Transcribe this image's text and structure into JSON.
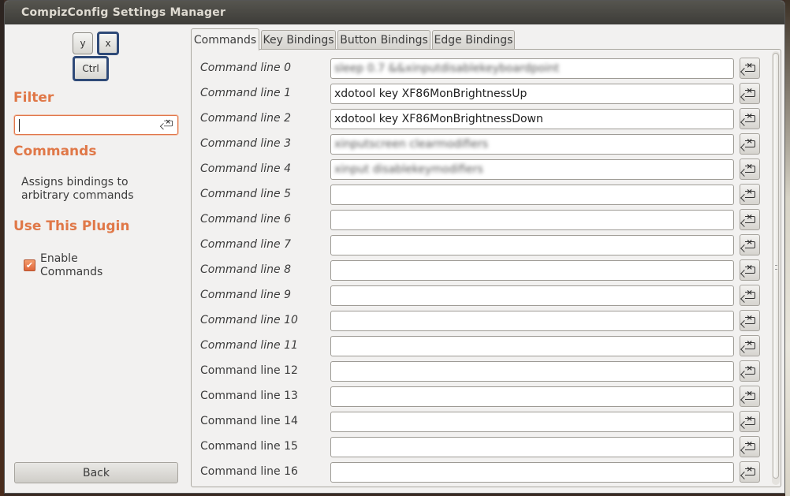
{
  "window": {
    "title": "CompizConfig Settings Manager"
  },
  "plugin_icon": {
    "keys": [
      "y",
      "x",
      "Ctrl"
    ]
  },
  "sidebar": {
    "filter_heading": "Filter",
    "filter_value": "",
    "plugin_heading": "Commands",
    "plugin_description_line1": "Assigns bindings to",
    "plugin_description_line2": "arbitrary commands",
    "use_heading": "Use This Plugin",
    "enable_label_line1": "Enable",
    "enable_label_line2": "Commands",
    "enable_checked": true,
    "back_label": "Back"
  },
  "tabs": [
    "Commands",
    "Key Bindings",
    "Button Bindings",
    "Edge Bindings"
  ],
  "active_tab": 0,
  "rows": [
    {
      "label": "Command line 0",
      "value": "sleep 0.7 &&xinputdisablekeyboardpoint",
      "italic": true,
      "blurred": true
    },
    {
      "label": "Command line 1",
      "value": "xdotool key XF86MonBrightnessUp",
      "italic": true,
      "blurred": false
    },
    {
      "label": "Command line 2",
      "value": "xdotool key XF86MonBrightnessDown",
      "italic": true,
      "blurred": false
    },
    {
      "label": "Command line 3",
      "value": "xinputscreen clearmodifiers",
      "italic": true,
      "blurred": true
    },
    {
      "label": "Command line 4",
      "value": "xinput disablekeymodifiers",
      "italic": true,
      "blurred": true
    },
    {
      "label": "Command line 5",
      "value": "",
      "italic": true,
      "blurred": false
    },
    {
      "label": "Command line 6",
      "value": "",
      "italic": true,
      "blurred": false
    },
    {
      "label": "Command line 7",
      "value": "",
      "italic": true,
      "blurred": false
    },
    {
      "label": "Command line 8",
      "value": "",
      "italic": true,
      "blurred": false
    },
    {
      "label": "Command line 9",
      "value": "",
      "italic": true,
      "blurred": false
    },
    {
      "label": "Command line 10",
      "value": "",
      "italic": true,
      "blurred": false
    },
    {
      "label": "Command line 11",
      "value": "",
      "italic": true,
      "blurred": false
    },
    {
      "label": "Command line 12",
      "value": "",
      "italic": false,
      "blurred": false
    },
    {
      "label": "Command line 13",
      "value": "",
      "italic": false,
      "blurred": false
    },
    {
      "label": "Command line 14",
      "value": "",
      "italic": false,
      "blurred": false
    },
    {
      "label": "Command line 15",
      "value": "",
      "italic": false,
      "blurred": false
    },
    {
      "label": "Command line 16",
      "value": "",
      "italic": false,
      "blurred": false
    }
  ],
  "colors": {
    "accent": "#e07848",
    "titlebar": "#3d3c38",
    "panel": "#f2f1f0"
  },
  "icons": {
    "clear": "edit-clear-icon",
    "check": "checkmark-icon"
  }
}
